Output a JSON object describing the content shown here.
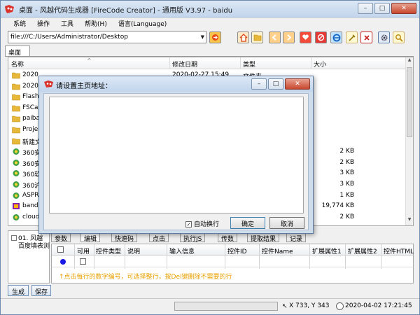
{
  "window": {
    "title": "桌面 - 风越代码生成器 [FireCode Creator] - 通用版 V3.97 - baidu",
    "min_label": "–",
    "max_label": "□",
    "close_label": "✕"
  },
  "menu": [
    "系统",
    "操作",
    "工具",
    "帮助(H)",
    "语言(Language)"
  ],
  "toolbar": {
    "address": "file:///C:/Users/Administrator/Desktop",
    "address_arrow": "▼"
  },
  "doc_tab": "桌面",
  "filelist": {
    "columns": [
      "名称",
      "修改日期",
      "类型",
      "大小"
    ],
    "sort_arrow": "^",
    "rows": [
      {
        "name": "2020",
        "date": "2020-02-27 15:49",
        "type": "文件夹",
        "size": "",
        "icon": "folder"
      },
      {
        "name": "2020",
        "date": "",
        "type": "",
        "size": "",
        "icon": "folder"
      },
      {
        "name": "Flasht",
        "date": "",
        "type": "",
        "size": "",
        "icon": "folder"
      },
      {
        "name": "FSCap",
        "date": "",
        "type": "",
        "size": "",
        "icon": "folder"
      },
      {
        "name": "paiba",
        "date": "",
        "type": "",
        "size": "",
        "icon": "folder"
      },
      {
        "name": "Proje",
        "date": "",
        "type": "",
        "size": "",
        "icon": "folder"
      },
      {
        "name": "新建文",
        "date": "",
        "type": "",
        "size": "",
        "icon": "folder"
      },
      {
        "name": "360安",
        "date": "",
        "type": "",
        "size": "2 KB",
        "icon": "shortcut"
      },
      {
        "name": "360安",
        "date": "",
        "type": "",
        "size": "2 KB",
        "icon": "shortcut"
      },
      {
        "name": "360软",
        "date": "",
        "type": "",
        "size": "3 KB",
        "icon": "shortcut"
      },
      {
        "name": "360沪",
        "date": "",
        "type": "",
        "size": "3 KB",
        "icon": "shortcut"
      },
      {
        "name": "ASPR",
        "date": "",
        "type": "",
        "size": "1 KB",
        "icon": "shortcut"
      },
      {
        "name": "bandi",
        "date": "",
        "type": "",
        "size": "19,774 KB",
        "icon": "app"
      },
      {
        "name": "cloud",
        "date": "",
        "type": "",
        "size": "2 KB",
        "icon": "shortcut"
      }
    ]
  },
  "lower_left": {
    "line1": "01. 风越",
    "line2": "百度填表浏"
  },
  "lower_tabs": [
    "参数",
    "编辑",
    "快速码",
    "点击",
    "执行JS",
    "传数",
    "提取结果",
    "记录"
  ],
  "grid": {
    "columns": [
      "可用",
      "控件类型",
      "说明",
      "输入信息",
      "控件ID",
      "控件Name",
      "扩展属性1",
      "扩展属性2",
      "控件HTML"
    ],
    "hint": "↑点击每行的数字编号，可选择整行，按Del键删除不需要的行"
  },
  "buttons": {
    "generate": "生成",
    "save": "保存"
  },
  "status": {
    "coords": "X 733, Y 343",
    "datetime": "2020-04-02 17:21:45"
  },
  "dialog": {
    "title": "请设置主页地址：",
    "textarea_value": "",
    "wrap_label": "自动换行",
    "wrap_checked": true,
    "ok_label": "确定",
    "cancel_label": "取消",
    "check_mark": "✓"
  },
  "colors": {
    "accent": "#1a1ae6",
    "hint": "#e8a000",
    "folder": "#e7b83a"
  }
}
